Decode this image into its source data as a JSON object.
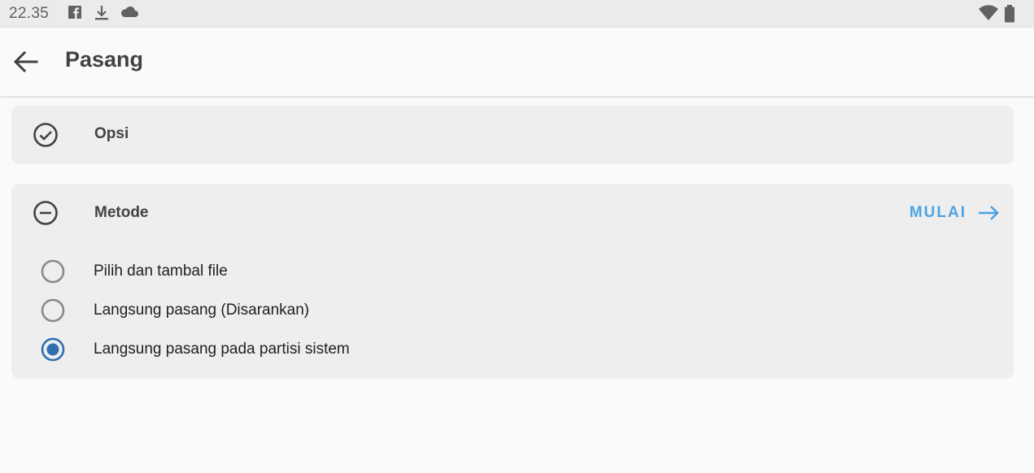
{
  "status_bar": {
    "time": "22.35",
    "icons": [
      "facebook-icon",
      "download-icon",
      "cloud-icon",
      "wifi-icon",
      "battery-icon"
    ]
  },
  "app_bar": {
    "title": "Pasang",
    "back_icon": "arrow-back-icon"
  },
  "cards": {
    "options": {
      "title": "Opsi",
      "icon": "check-circle-icon",
      "state": "completed"
    },
    "method": {
      "title": "Metode",
      "icon": "minus-circle-icon",
      "action_label": "MULAI",
      "action_icon": "arrow-forward-icon",
      "choices": [
        {
          "label": "Pilih dan tambal file",
          "selected": false
        },
        {
          "label": "Langsung pasang (Disarankan)",
          "selected": false
        },
        {
          "label": "Langsung pasang pada partisi sistem",
          "selected": true
        }
      ]
    }
  },
  "colors": {
    "accent": "#4aa3e6",
    "radio_selected": "#2f6fb0",
    "radio_unselected": "#8a8a8a",
    "card_bg": "#eeeeee",
    "page_bg": "#fafafa",
    "status_bar_bg": "#ebebeb"
  }
}
